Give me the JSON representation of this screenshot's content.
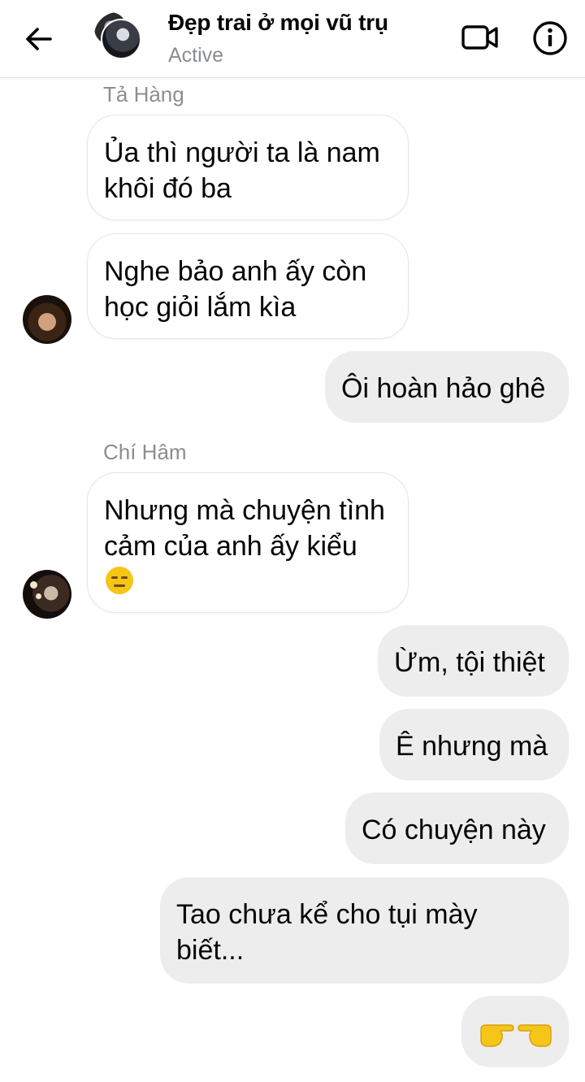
{
  "header": {
    "title": "Đẹp trai ở mọi vũ trụ",
    "status": "Active",
    "back_icon": "arrow-left-icon",
    "video_icon": "video-camera-icon",
    "info_icon": "info-icon"
  },
  "messages": [
    {
      "sender": "Tả Hàng",
      "side": "incoming",
      "text": "Ủa thì người ta là nam khôi đó ba"
    },
    {
      "side": "incoming",
      "text": "Nghe bảo anh ấy còn học giỏi lắm kìa"
    },
    {
      "side": "outgoing",
      "text": "Ôi hoàn hảo ghê"
    },
    {
      "sender": "Chí Hâm",
      "side": "incoming",
      "text": "Nhưng mà chuyện tình cảm của anh ấy kiểu",
      "emoji": "expressionless-face-emoji"
    },
    {
      "side": "outgoing",
      "text": "Ừm, tội thiệt"
    },
    {
      "side": "outgoing",
      "text": "Ê nhưng mà"
    },
    {
      "side": "outgoing",
      "text": "Có chuyện này"
    },
    {
      "side": "outgoing",
      "text": "Tao chưa kể cho tụi mày biết..."
    },
    {
      "side": "outgoing",
      "emoji": "pointing-hands-emoji"
    }
  ],
  "colors": {
    "outgoing_bubble": "#ededed",
    "incoming_bubble": "#ffffff",
    "secondary_text": "#8a8d91",
    "emoji_yellow": "#f5c518"
  }
}
